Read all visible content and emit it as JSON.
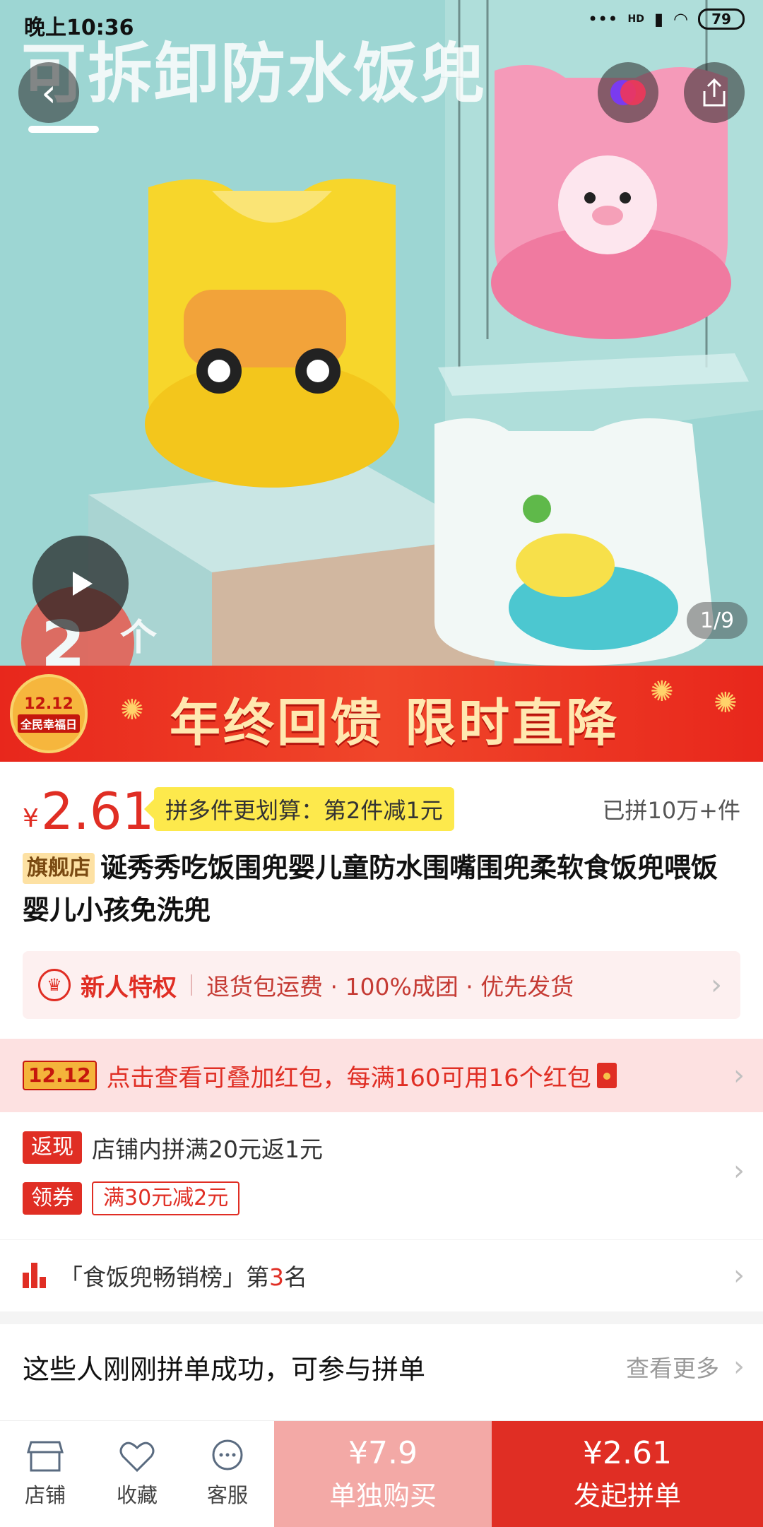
{
  "status_bar": {
    "time": "晚上10:36",
    "network": "HD",
    "battery": "79"
  },
  "hero": {
    "title": "可拆卸防水饭兜",
    "counter": "1/9",
    "badge_number": "2",
    "badge_text": "个"
  },
  "banner": {
    "logo_date": "12.12",
    "logo_text": "全民幸福日",
    "text": "年终回馈 限时直降"
  },
  "product": {
    "price_symbol": "¥",
    "price": "2.61",
    "deal": "拼多件更划算：第2件减1元",
    "sold": "已拼10万+件",
    "flag": "旗舰店",
    "title": "诞秀秀吃饭围兜婴儿童防水围嘴围兜柔软食饭兜喂饭婴儿小孩免洗兜"
  },
  "newbie": {
    "title": "新人特权",
    "perks": "退货包运费 · 100%成团 · 优先发货"
  },
  "redpack": {
    "badge": "12.12",
    "text": "点击查看可叠加红包，每满160可用16个红包"
  },
  "coupons": {
    "cashback_tag": "返现",
    "cashback_text": "店铺内拼满20元返1元",
    "coupon_tag": "领券",
    "coupon_text": "满30元减2元"
  },
  "rank": {
    "prefix": "「食饭兜畅销榜」第",
    "number": "3",
    "suffix": "名"
  },
  "groups": {
    "title": "这些人刚刚拼单成功，可参与拼单",
    "more": "查看更多"
  },
  "bottom_bar": {
    "store": "店铺",
    "favorite": "收藏",
    "service": "客服",
    "solo_price": "¥7.9",
    "solo_label": "单独购买",
    "group_price": "¥2.61",
    "group_label": "发起拼单"
  },
  "colors": {
    "accent": "#e02e24",
    "deal_yellow": "#fde94c",
    "solo_pink": "#f3a9a6"
  }
}
